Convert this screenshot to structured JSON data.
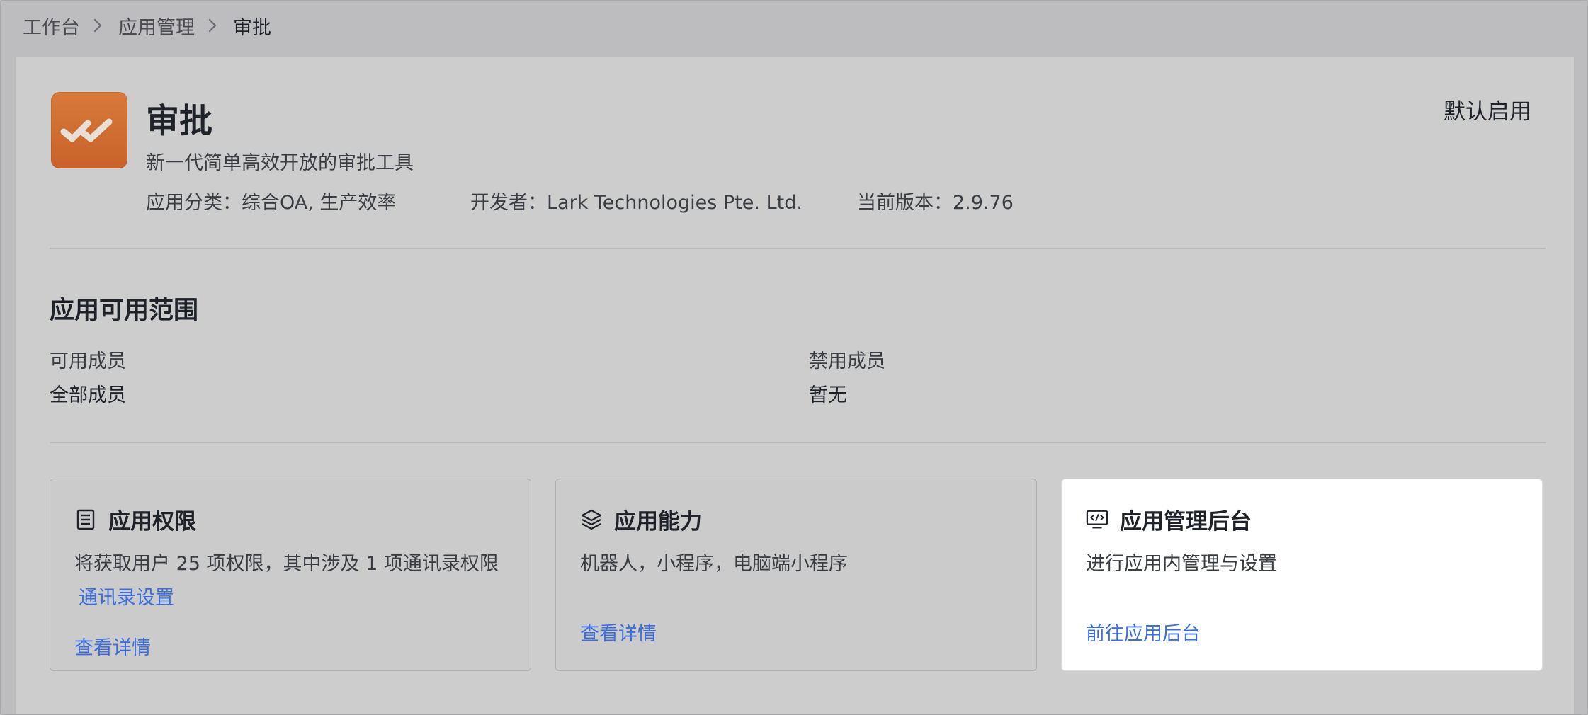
{
  "breadcrumb": {
    "items": [
      "工作台",
      "应用管理",
      "审批"
    ]
  },
  "app": {
    "name": "审批",
    "description": "新一代简单高效开放的审批工具",
    "category": "应用分类：综合OA, 生产效率",
    "developer": "开发者：Lark Technologies Pte. Ltd.",
    "version": "当前版本：2.9.76",
    "default_enable": "默认启用",
    "logo_color": "#cf6a2f"
  },
  "scope": {
    "title": "应用可用范围",
    "available_label": "可用成员",
    "available_value": "全部成员",
    "disabled_label": "禁用成员",
    "disabled_value": "暂无"
  },
  "cards": [
    {
      "title": "应用权限",
      "icon": "list-document-icon",
      "description": "将获取用户 25 项权限，其中涉及 1 项通讯录权限",
      "inline_link": "通讯录设置",
      "link": "查看详情"
    },
    {
      "title": "应用能力",
      "icon": "layers-icon",
      "description": "机器人，小程序，电脑端小程序",
      "link": "查看详情"
    },
    {
      "title": "应用管理后台",
      "icon": "code-monitor-icon",
      "description": "进行应用内管理与设置",
      "link": "前往应用后台"
    }
  ],
  "colors": {
    "link": "#3b6fe0",
    "overlay": "#cdcdcd",
    "highlight": "#ffffff"
  }
}
